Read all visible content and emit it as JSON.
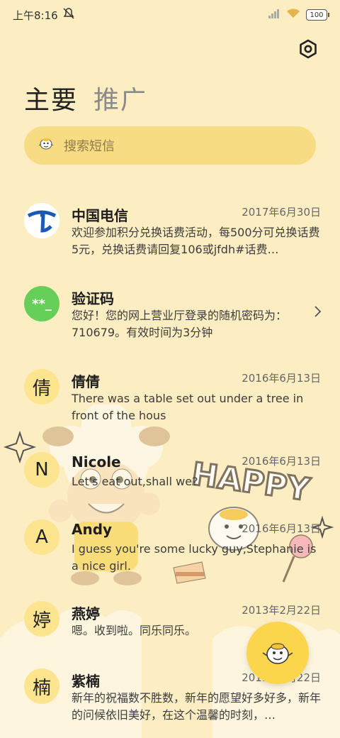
{
  "status_bar": {
    "time": "上午8:16",
    "battery": "100"
  },
  "tabs": [
    {
      "label": "主要"
    },
    {
      "label": "推广"
    }
  ],
  "search": {
    "placeholder": "搜索短信"
  },
  "conversations": [
    {
      "name": "中国电信",
      "date": "2017年6月30日",
      "snippet": "欢迎参加积分兑换话费活动，每500分可兑换话费5元，兑换话费请回复106或jfdh#话费…",
      "avatar": "telecom-logo"
    },
    {
      "name": "验证码",
      "date": "",
      "snippet": "您好！您的网上营业厅登录的随机密码为：710679。有效时间为3分钟",
      "avatar_text": "**_"
    },
    {
      "name": "倩倩",
      "date": "2016年6月13日",
      "snippet": "There was a table set out under a tree in front of the hous",
      "avatar_text": "倩"
    },
    {
      "name": "Nicole",
      "date": "2016年6月13日",
      "snippet": "Let's eat out,shall we?",
      "avatar_text": "N"
    },
    {
      "name": "Andy",
      "date": "2016年6月13日",
      "snippet": "I guess you're some lucky guy,Stephanie is a nice girl.",
      "avatar_text": "A"
    },
    {
      "name": "燕婷",
      "date": "2013年2月22日",
      "snippet": "嗯。收到啦。同乐同乐。",
      "avatar_text": "婷"
    },
    {
      "name": "紫楠",
      "date": "2013年2月22日",
      "snippet": "新年的祝福数不胜数，新年的愿望好多好多，新年的问候依旧美好，在这个温馨的时刻，…",
      "avatar_text": "楠"
    }
  ],
  "decoration": {
    "happy_text": "HAPPY"
  },
  "colors": {
    "background": "#fcedc2",
    "search_bg": "#f8dc83",
    "avatar_bg": "#fde48e",
    "green": "#65cf5a",
    "fab": "#fbd64c"
  }
}
